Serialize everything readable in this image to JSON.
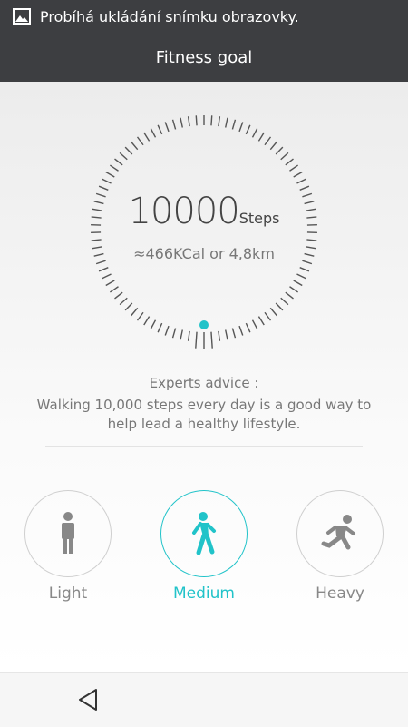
{
  "status_bar": {
    "notification": "Probíhá ukládání snímku obrazovky."
  },
  "header": {
    "title": "Fitness goal"
  },
  "goal": {
    "steps_value": "10000",
    "steps_unit": "Steps",
    "equivalent": "≈466KCal  or  4,8km"
  },
  "advice": {
    "title": "Experts advice :",
    "text": "Walking 10,000 steps every day is a good way to help lead a healthy lifestyle."
  },
  "levels": [
    {
      "label": "Light",
      "icon": "standing-person-icon",
      "selected": false
    },
    {
      "label": "Medium",
      "icon": "walking-person-icon",
      "selected": true
    },
    {
      "label": "Heavy",
      "icon": "running-person-icon",
      "selected": false
    }
  ],
  "colors": {
    "accent": "#21c3c9",
    "header_bg": "#3d3e41",
    "tick": "#555555"
  },
  "nav": {
    "back_icon": "back-triangle-icon"
  }
}
